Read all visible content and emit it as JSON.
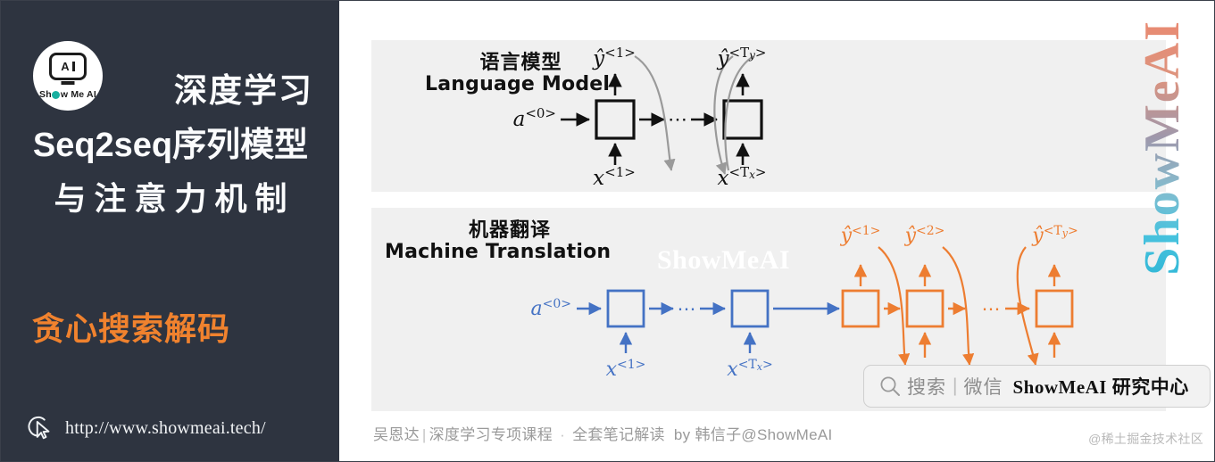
{
  "sidebar": {
    "logo": {
      "icon": "robot-head-icon",
      "badge_letters": "A",
      "brand": "Show Me AI"
    },
    "title_line1": "深度学习",
    "title_line2": "Seq2seq序列模型",
    "title_line3": "与注意力机制",
    "subtitle": "贪心搜索解码",
    "url": "http://www.showmeai.tech/",
    "cursor_icon": "cursor-pointer-icon",
    "bg_color": "#2e3440",
    "accent_color": "#f0822e"
  },
  "panels": [
    {
      "id": "language-model",
      "heading_cn": "语言模型",
      "heading_en": "Language Model",
      "color": "#1a1a1a",
      "nodes": [
        {
          "input": "a<0>",
          "output": "ŷ<1>",
          "x_label": "x<1>"
        },
        {
          "ellipsis": "⋯"
        },
        {
          "output": "ŷ<Ty>",
          "x_label": "x<Tx>"
        }
      ]
    },
    {
      "id": "machine-translation",
      "heading_cn": "机器翻译",
      "heading_en": "Machine Translation",
      "encoder_color": "#4472c4",
      "decoder_color": "#ed7d31",
      "encoder": [
        {
          "input": "a<0>",
          "x_label": "x<1>"
        },
        {
          "ellipsis": "⋯"
        },
        {
          "x_label": "x<Tx>"
        }
      ],
      "decoder": [
        {
          "output": "ŷ<1>"
        },
        {
          "output": "ŷ<2>"
        },
        {
          "ellipsis": "⋯"
        },
        {
          "output": "ŷ<Ty>"
        }
      ],
      "watermark": "ShowMeAI"
    }
  ],
  "search_pill": {
    "icon": "magnifier-icon",
    "label": "搜索",
    "divider": "|",
    "channel": "微信",
    "account": "ShowMeAI 研究中心"
  },
  "footer": {
    "author": "吴恩达",
    "separator1": "|",
    "course": "深度学习专项课程",
    "dot": "·",
    "notes": "全套笔记解读",
    "by": "by 韩信子@ShowMeAI"
  },
  "credit": "@稀土掘金技术社区",
  "vertical_watermark": "ShowMeAI"
}
